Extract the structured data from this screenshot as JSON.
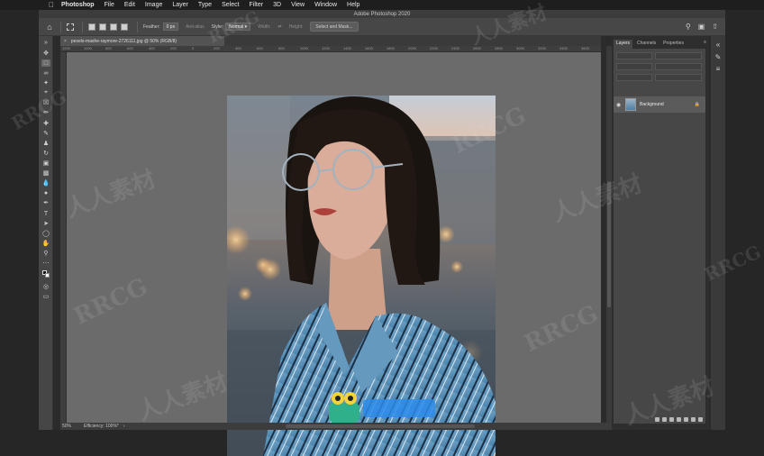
{
  "menubar": {
    "app": "Photoshop",
    "items": [
      "File",
      "Edit",
      "Image",
      "Layer",
      "Type",
      "Select",
      "Filter",
      "3D",
      "View",
      "Window",
      "Help"
    ]
  },
  "window": {
    "title": "Adobe Photoshop 2020"
  },
  "options": {
    "feather_label": "Feather:",
    "feather_value": "0 px",
    "antialias_label": "Anti-alias",
    "style_label": "Style:",
    "style_value": "Normal",
    "width_label": "Width:",
    "height_label": "Height:",
    "select_mask_label": "Select and Mask..."
  },
  "document": {
    "tab_title": "pexels-mashe-raymore-2726111.jpg @ 50% (RGB/8)"
  },
  "ruler": {
    "ticks": [
      "1200",
      "1000",
      "800",
      "600",
      "400",
      "200",
      "0",
      "200",
      "400",
      "600",
      "800",
      "1000",
      "1200",
      "1400",
      "1600",
      "1800",
      "2000",
      "2200",
      "2400",
      "2600",
      "2800",
      "3000",
      "3200",
      "3400",
      "3600"
    ]
  },
  "status": {
    "zoom": "50%",
    "efficiency": "Efficiency: 100%*"
  },
  "panels": {
    "tabs": [
      "Layers",
      "Channels",
      "Properties"
    ],
    "layer_name": "Background"
  },
  "watermarks": [
    "RRCG",
    "人人素材"
  ],
  "colors": {
    "accent": "#2d8ceb",
    "canvas_bg": "#6b6b6b",
    "panel_bg": "#474747"
  }
}
